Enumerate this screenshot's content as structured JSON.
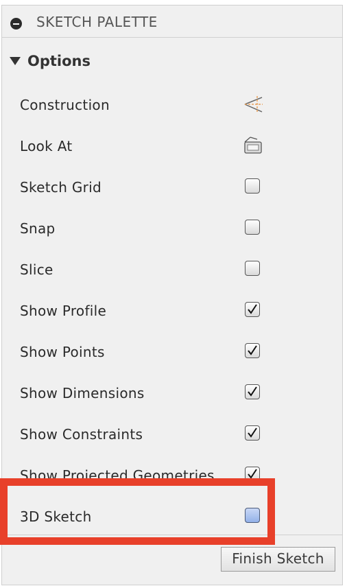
{
  "header": {
    "title": "SKETCH PALETTE",
    "collapse_icon": "collapse-minus-icon"
  },
  "options": {
    "label": "Options",
    "expanded": true
  },
  "rows": [
    {
      "label": "Construction",
      "control": "construction-icon"
    },
    {
      "label": "Look At",
      "control": "look-at-icon"
    },
    {
      "label": "Sketch Grid",
      "control": "checkbox",
      "checked": false
    },
    {
      "label": "Snap",
      "control": "checkbox",
      "checked": false
    },
    {
      "label": "Slice",
      "control": "checkbox",
      "checked": false
    },
    {
      "label": "Show Profile",
      "control": "checkbox",
      "checked": true
    },
    {
      "label": "Show Points",
      "control": "checkbox",
      "checked": true
    },
    {
      "label": "Show Dimensions",
      "control": "checkbox",
      "checked": true
    },
    {
      "label": "Show Constraints",
      "control": "checkbox",
      "checked": true
    },
    {
      "label": "Show Projected Geometries",
      "control": "checkbox",
      "checked": true
    },
    {
      "label": "3D Sketch",
      "control": "checkbox",
      "checked": false,
      "highlighted": true
    }
  ],
  "footer": {
    "finish_label": "Finish Sketch"
  },
  "colors": {
    "highlight": "#e8402a",
    "panel_bg": "#f0f0f0",
    "blue_checkbox": "#a9c0ee"
  }
}
